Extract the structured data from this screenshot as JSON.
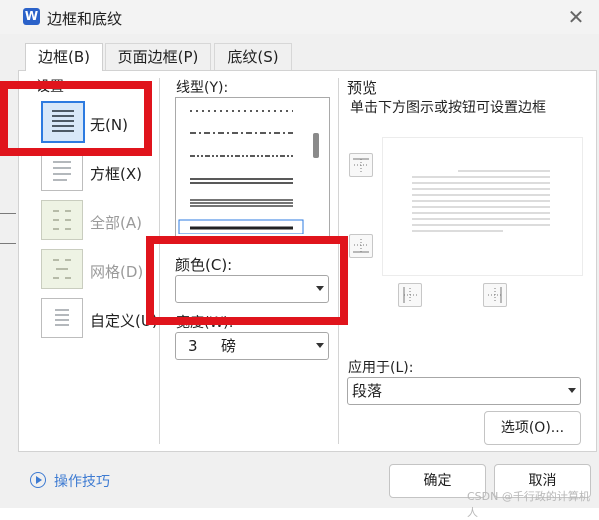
{
  "window": {
    "title": "边框和底纹",
    "app_icon_letter": "W"
  },
  "tabs": [
    "边框(B)",
    "页面边框(P)",
    "底纹(S)"
  ],
  "settings": {
    "label": "设置",
    "items": [
      "无(N)",
      "方框(X)",
      "全部(A)",
      "网格(D)",
      "自定义(U)"
    ]
  },
  "line_style": {
    "label": "线型(Y):"
  },
  "color": {
    "label": "颜色(C):",
    "value": ""
  },
  "width": {
    "label_visible": "宽度(W):",
    "value_number": "3",
    "value_unit": "磅"
  },
  "preview": {
    "label": "预览",
    "hint": "单击下方图示或按钮可设置边框"
  },
  "apply_to": {
    "label": "应用于(L):",
    "value": "段落"
  },
  "buttons": {
    "options": "选项(O)...",
    "ok": "确定",
    "cancel": "取消"
  },
  "footer": {
    "tips": "操作技巧"
  },
  "watermark": "CSDN @千行政的计算机人",
  "colors": {
    "accent_red": "#e0141c",
    "link_blue": "#3e7bd2",
    "selected_blue": "#2d7be0"
  }
}
